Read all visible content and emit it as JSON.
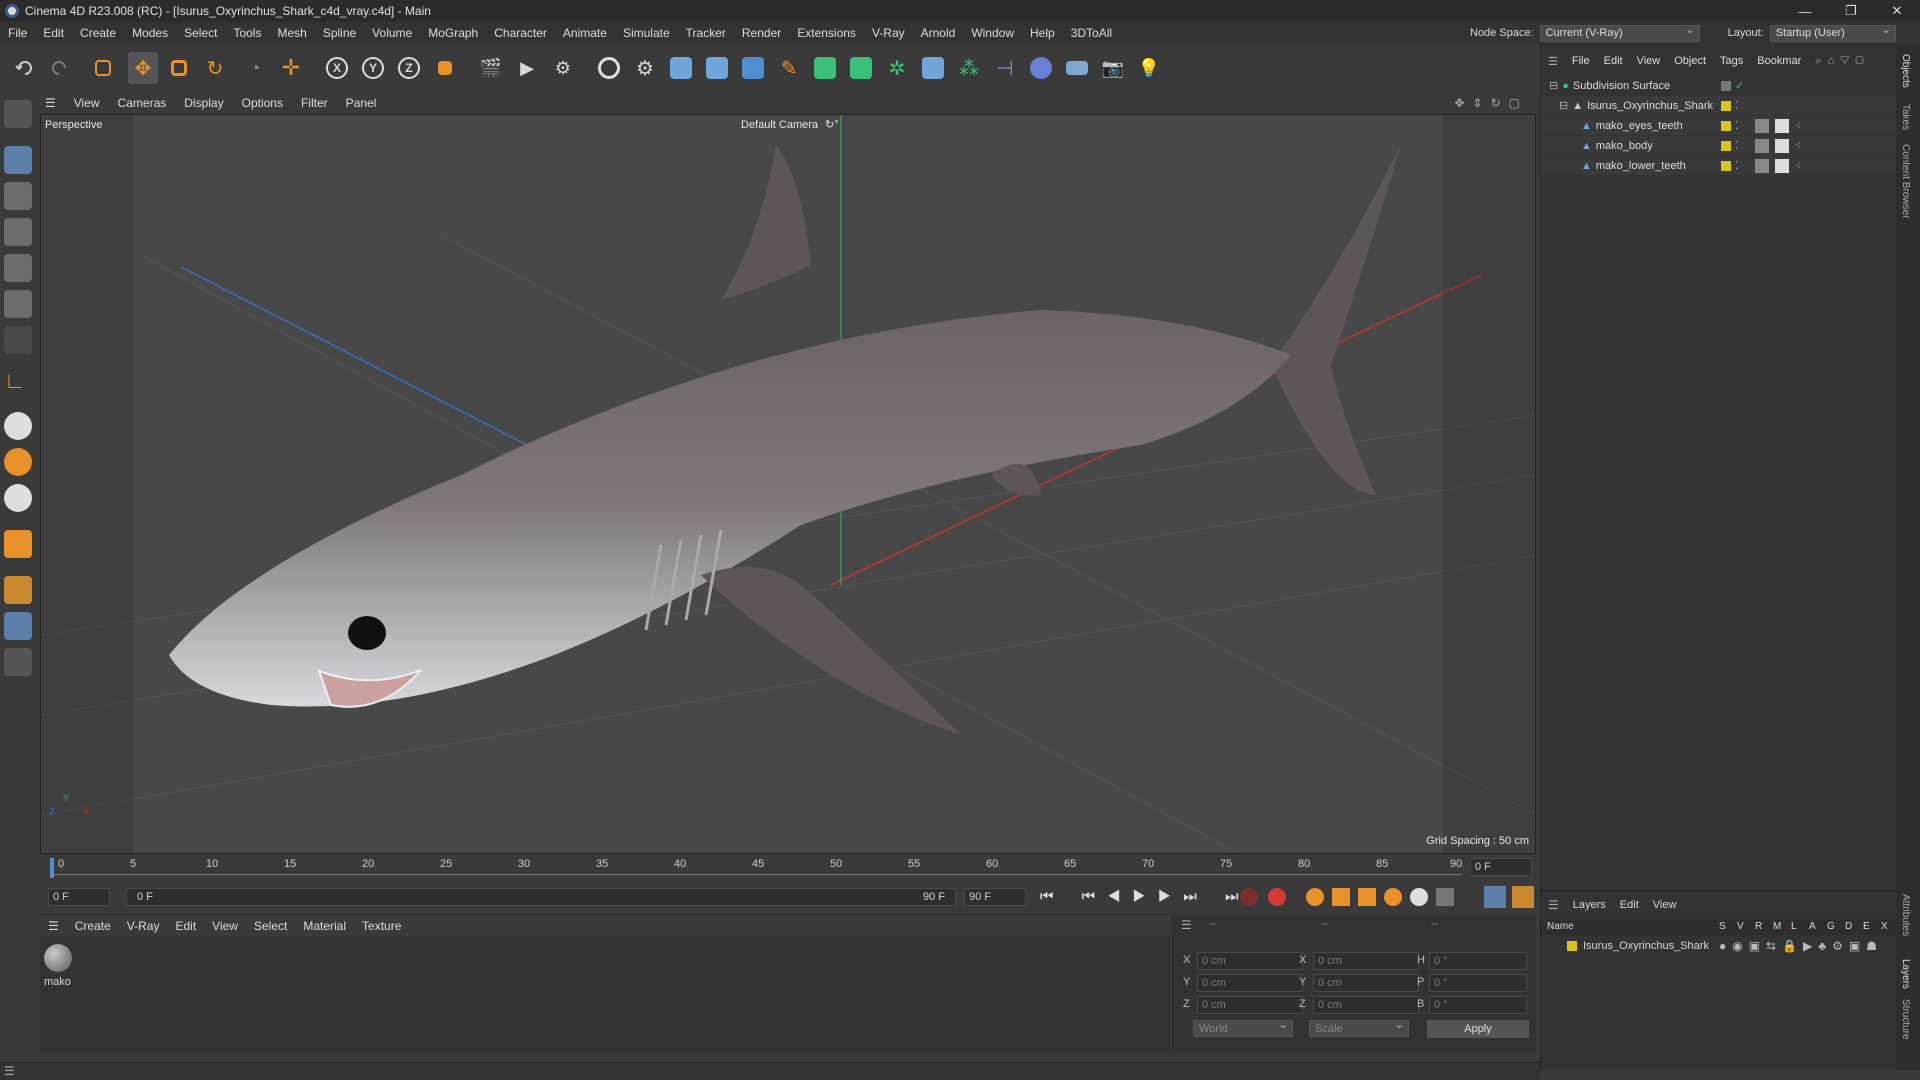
{
  "window": {
    "title": "Cinema 4D R23.008 (RC) - [Isurus_Oxyrinchus_Shark_c4d_vray.c4d] - Main",
    "minimize": "—",
    "maximize": "❐",
    "close": "✕"
  },
  "menubar": {
    "items": [
      "File",
      "Edit",
      "Create",
      "Modes",
      "Select",
      "Tools",
      "Mesh",
      "Spline",
      "Volume",
      "MoGraph",
      "Character",
      "Animate",
      "Simulate",
      "Tracker",
      "Render",
      "Extensions",
      "V-Ray",
      "Arnold",
      "Window",
      "Help",
      "3DToAll"
    ],
    "node_space_label": "Node Space:",
    "node_space_value": "Current (V-Ray)",
    "layout_label": "Layout:",
    "layout_value": "Startup (User)"
  },
  "viewport": {
    "menu": [
      "View",
      "Cameras",
      "Display",
      "Options",
      "Filter",
      "Panel"
    ],
    "view_name": "Perspective",
    "camera": "Default Camera",
    "camera_icon": "↻°",
    "grid_spacing": "Grid Spacing : 50 cm",
    "axis_y": "Y",
    "axis_z": "Z",
    "axis_x": "X"
  },
  "timeline": {
    "ticks": [
      "0",
      "5",
      "10",
      "15",
      "20",
      "25",
      "30",
      "35",
      "40",
      "45",
      "50",
      "55",
      "60",
      "65",
      "70",
      "75",
      "80",
      "85",
      "90"
    ],
    "current_frame_right": "0 F",
    "start_field": "0 F",
    "range_start": "0 F",
    "range_end": "90 F",
    "end_field": "90 F"
  },
  "material_panel": {
    "menu": [
      "Create",
      "V-Ray",
      "Edit",
      "View",
      "Select",
      "Material",
      "Texture"
    ],
    "material_name": "mako"
  },
  "coords": {
    "header_dashes": [
      "--",
      "--",
      "--"
    ],
    "rows": [
      {
        "a": "X",
        "av": "0 cm",
        "b": "X",
        "bv": "0 cm",
        "c": "H",
        "cv": "0 °"
      },
      {
        "a": "Y",
        "av": "0 cm",
        "b": "Y",
        "bv": "0 cm",
        "c": "P",
        "cv": "0 °"
      },
      {
        "a": "Z",
        "av": "0 cm",
        "b": "Z",
        "bv": "0 cm",
        "c": "B",
        "cv": "0 °"
      }
    ],
    "world": "World",
    "scale": "Scale",
    "apply": "Apply"
  },
  "objects": {
    "menu": [
      "File",
      "Edit",
      "View",
      "Object",
      "Tags",
      "Bookmar"
    ],
    "items": [
      {
        "name": "Subdivision Surface",
        "indent": 0
      },
      {
        "name": "Isurus_Oxyrinchus_Shark",
        "indent": 1
      },
      {
        "name": "mako_eyes_teeth",
        "indent": 2
      },
      {
        "name": "mako_body",
        "indent": 2
      },
      {
        "name": "mako_lower_teeth",
        "indent": 2
      }
    ]
  },
  "layers": {
    "menu": [
      "Layers",
      "Edit",
      "View"
    ],
    "col_name": "Name",
    "cols": [
      "S",
      "V",
      "R",
      "M",
      "L",
      "A",
      "G",
      "D",
      "E",
      "X"
    ],
    "row": "Isurus_Oxyrinchus_Shark"
  },
  "side_tabs": [
    "Objects",
    "Takes",
    "Content Browser",
    "Attributes",
    "Layers",
    "Structure"
  ],
  "colors": {
    "accent": "#e8902a",
    "layer_yellow": "#d9c419",
    "axis_red": "#c0352f",
    "axis_green": "#2fae4b",
    "axis_blue": "#3a6fc4"
  }
}
